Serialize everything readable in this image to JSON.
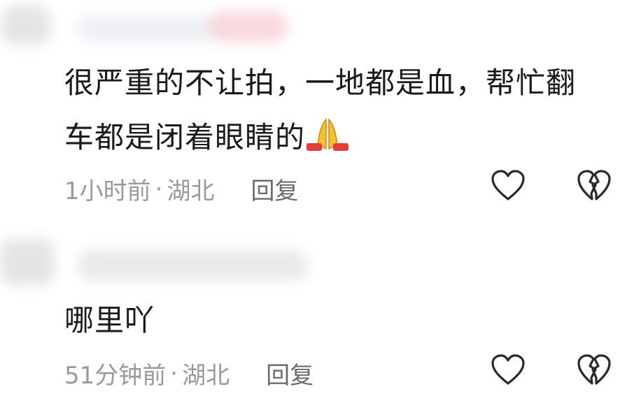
{
  "comments": [
    {
      "text_line1": "很严重的不让拍，一地都是血，帮忙翻",
      "text_line2": "车都是闭着眼睛的",
      "emoji": "folded-hands",
      "time": "1小时前",
      "separator": "·",
      "location": "湖北",
      "reply_label": "回复"
    },
    {
      "text_line1": "哪里吖",
      "time": "51分钟前",
      "separator": "·",
      "location": "湖北",
      "reply_label": "回复"
    }
  ],
  "icons": {
    "like": "heart-outline-icon",
    "dislike": "broken-heart-icon"
  },
  "colors": {
    "text": "#1a1a1a",
    "meta": "#9a9a9a",
    "reply": "#6b6b6b",
    "icon": "#2a2a2a",
    "blur_pink": "#f2b8c3",
    "blur_gray": "#cfcfcf"
  }
}
